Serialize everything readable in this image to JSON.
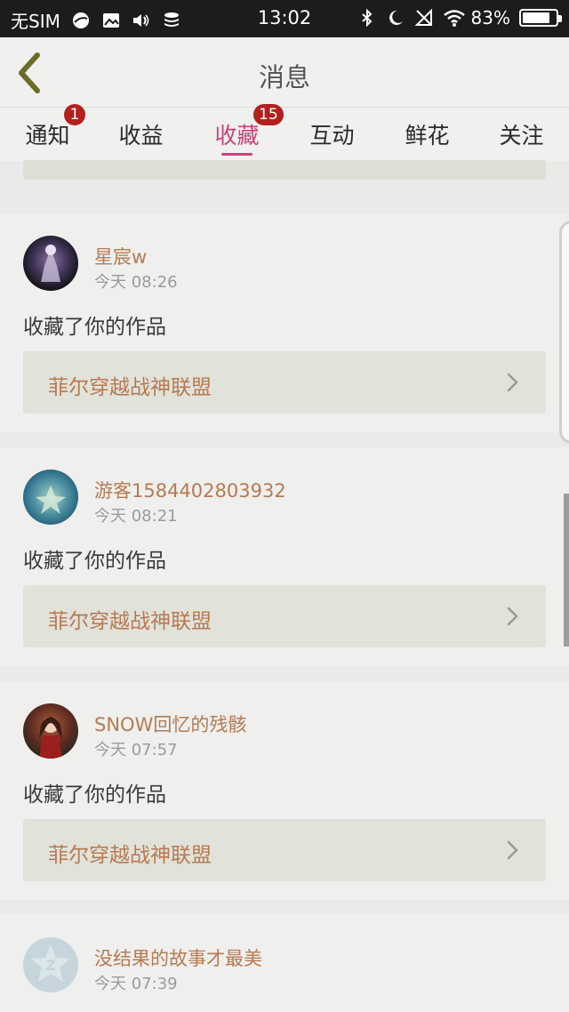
{
  "status_bar": {
    "carrier": "无SIM",
    "time": "13:02",
    "battery_percent": "83%",
    "battery_level": 0.83,
    "left_icons": [
      "app-icon",
      "image-icon",
      "volume-icon",
      "stack-icon"
    ],
    "right_icons": [
      "bluetooth-icon",
      "moon-icon",
      "mute-icon",
      "wifi-icon"
    ]
  },
  "header": {
    "title": "消息",
    "back_icon": "chevron-left-icon"
  },
  "tabs": [
    {
      "label": "通知",
      "badge": "1"
    },
    {
      "label": "收益",
      "badge": null
    },
    {
      "label": "收藏",
      "badge": "15",
      "active": true
    },
    {
      "label": "互动",
      "badge": null
    },
    {
      "label": "鲜花",
      "badge": null
    },
    {
      "label": "关注",
      "badge": null
    }
  ],
  "colors": {
    "accent": "#c8447a",
    "badge": "#b3201e",
    "name_text": "#b67a53"
  },
  "messages": [
    {
      "user": "星宸w",
      "time": "今天 08:26",
      "action": "收藏了你的作品",
      "work": "菲尔穿越战神联盟"
    },
    {
      "user": "游客1584402803932",
      "time": "今天 08:21",
      "action": "收藏了你的作品",
      "work": "菲尔穿越战神联盟"
    },
    {
      "user": "SNOW回忆的残骸",
      "time": "今天 07:57",
      "action": "收藏了你的作品",
      "work": "菲尔穿越战神联盟"
    },
    {
      "user": "没结果的故事才最美",
      "time": "今天 07:39"
    }
  ]
}
